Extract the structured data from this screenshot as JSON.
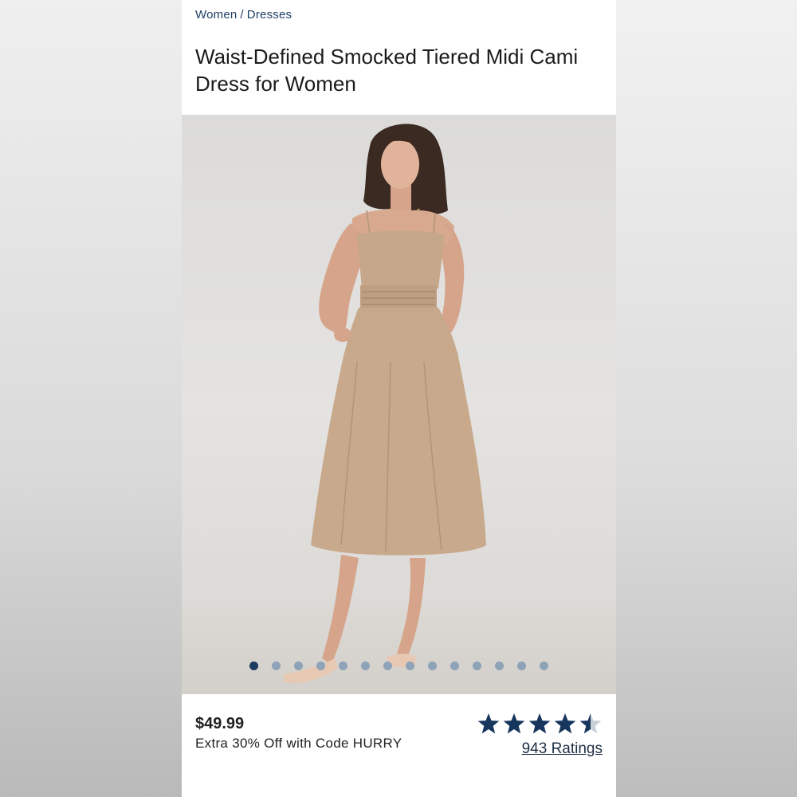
{
  "breadcrumb": {
    "items": [
      "Women",
      "Dresses"
    ],
    "separator": "/"
  },
  "product": {
    "title": "Waist-Defined Smocked Tiered Midi Cami Dress for Women",
    "image_alt_icon": "product-photo",
    "price": "$49.99",
    "promo": "Extra 30% Off with Code HURRY"
  },
  "carousel": {
    "total": 14,
    "active_index": 0
  },
  "rating": {
    "stars": 4.5,
    "max_stars": 5,
    "count_label": "943 Ratings",
    "star_color": "#17365d",
    "empty_color": "#c9cfd6"
  },
  "colors": {
    "breadcrumb": "#1f3f66",
    "dot_active": "#1a3a5e",
    "dot_inactive": "#8ea3b8"
  }
}
